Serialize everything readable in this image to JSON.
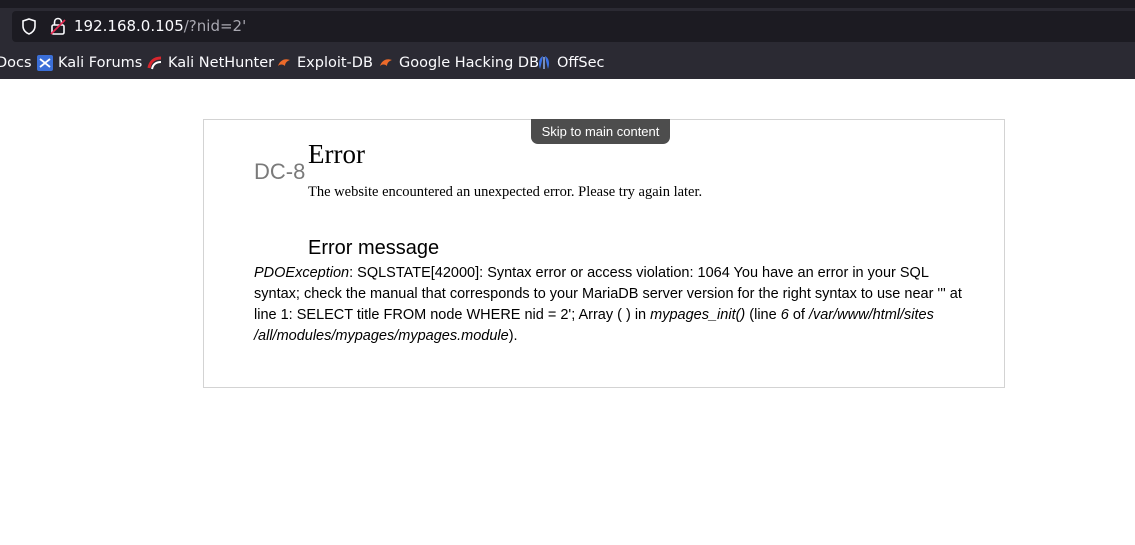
{
  "browser": {
    "url_host": "192.168.0.105",
    "url_path": "/?nid=2'",
    "bookmarks": [
      {
        "label": "Docs",
        "icon": "kali-docs-icon"
      },
      {
        "label": "Kali Forums",
        "icon": "kali-forums-icon"
      },
      {
        "label": "Kali NetHunter",
        "icon": "kali-nethunter-icon"
      },
      {
        "label": "Exploit-DB",
        "icon": "exploit-db-icon"
      },
      {
        "label": "Google Hacking DB",
        "icon": "google-hacking-db-icon"
      },
      {
        "label": "OffSec",
        "icon": "offsec-icon"
      }
    ]
  },
  "page": {
    "skip_link": "Skip to main content",
    "site_name": "DC-8",
    "title": "Error",
    "description": "The website encountered an unexpected error. Please try again later.",
    "message_heading": "Error message",
    "message": {
      "exception": "PDOException",
      "line1_rest": ": SQLSTATE[42000]: Syntax error or access violation: 1064 You have an error in your SQL",
      "line2": "syntax; check the manual that corresponds to your MariaDB server version for the right syntax to use near ''' at",
      "line3_a": "line 1: SELECT title FROM node WHERE nid = 2'; Array ( ) in ",
      "function": "mypages_init()",
      "line3_b": " (line ",
      "line_number": "6",
      "line3_c": " of ",
      "path_part1": "/var/www/html/sites",
      "path_part2": "/all/modules/mypages/mypages.module",
      "line4_end": ")."
    }
  }
}
